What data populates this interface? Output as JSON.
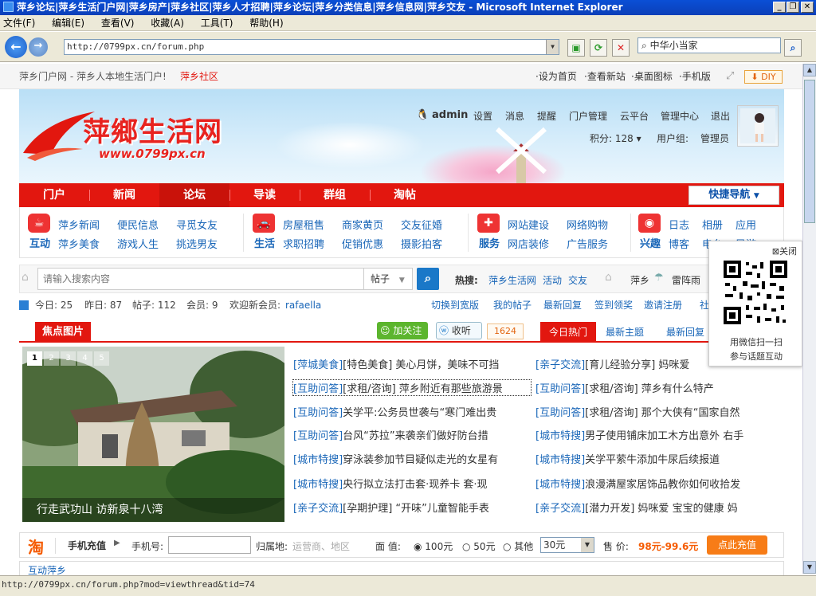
{
  "window": {
    "title": "萍乡论坛|萍乡生活门户网|萍乡房产|萍乡社区|萍乡人才招聘|萍乡论坛|萍乡分类信息|萍乡信息网|萍乡交友 - Microsoft Internet Explorer"
  },
  "menu": [
    "文件(F)",
    "编辑(E)",
    "查看(V)",
    "收藏(A)",
    "工具(T)",
    "帮助(H)"
  ],
  "address": {
    "url": "http://0799px.cn/forum.php"
  },
  "browser_search": {
    "value": "中华小当家"
  },
  "topstrip": {
    "site_desc": "萍乡门户网 - 萍乡人本地生活门户!",
    "community": "萍乡社区",
    "links": [
      "设为首页",
      "查看新站",
      "桌面图标",
      "手机版"
    ],
    "diy": "DIY"
  },
  "banner": {
    "logo_text": "萍鄉生活网",
    "logo_url": "www.0799px.cn",
    "user": "admin",
    "user_links": [
      "设置",
      "消息",
      "提醒",
      "门户管理",
      "云平台",
      "管理中心",
      "退出"
    ],
    "points_label": "积分: 128",
    "group_label": "用户组:",
    "group_value": "管理员"
  },
  "nav": {
    "items": [
      "门户",
      "新闻",
      "论坛",
      "导读",
      "群组",
      "淘帖"
    ],
    "fast_nav": "快捷导航"
  },
  "quick": {
    "groups": [
      {
        "icon": "cup-icon",
        "label": "互动",
        "links": [
          "萍乡新闻",
          "便民信息",
          "寻觅女友",
          "萍乡美食",
          "游戏人生",
          "挑选男友"
        ]
      },
      {
        "icon": "car-icon",
        "label": "生活",
        "links": [
          "房屋租售",
          "商家黄页",
          "交友征婚",
          "求职招聘",
          "促销优惠",
          "摄影拍客"
        ]
      },
      {
        "icon": "toolbox-icon",
        "label": "服务",
        "links": [
          "网站建设",
          "网络购物",
          "网店装修",
          "广告服务"
        ]
      },
      {
        "icon": "camera-icon",
        "label": "兴趣",
        "links": [
          "日志",
          "相册",
          "应用",
          "博客",
          "电台",
          "导游"
        ]
      }
    ]
  },
  "search": {
    "placeholder": "请输入搜索内容",
    "type": "帖子",
    "hot_label": "热搜:",
    "hot": [
      "萍乡生活网",
      "活动",
      "交友"
    ],
    "extra": "萍乡",
    "weather": "雷阵雨"
  },
  "stats": {
    "today": "今日: 25",
    "yesterday": "昨日: 87",
    "posts": "帖子: 112",
    "members": "会员: 9",
    "welcome": "欢迎新会员:",
    "new_member": "rafaella",
    "links": [
      "切换到宽版",
      "我的帖子",
      "最新回复",
      "签到领奖",
      "邀请注册",
      "社"
    ]
  },
  "focus": {
    "tab": "焦点图片",
    "follow": "加关注",
    "listen": "收听",
    "listen_count": "1624",
    "tabs": [
      "今日热门",
      "最新主题",
      "最新回复"
    ],
    "slides": [
      "1",
      "2",
      "3",
      "4",
      "5"
    ],
    "caption": "行走武功山  访新泉十八湾",
    "left_list": [
      {
        "tag": "[萍城美食]",
        "text": "[特色美食] 美心月饼，美味不可挡"
      },
      {
        "tag": "[互助问答]",
        "text": "[求租/咨询] 萍乡附近有那些旅游景"
      },
      {
        "tag": "[互助问答]",
        "text": "关学平:公务员世袭与“寒门难出贵"
      },
      {
        "tag": "[互助问答]",
        "text": "台风“苏拉”来袭亲们做好防台措"
      },
      {
        "tag": "[城市特搜]",
        "text": "穿泳装参加节目疑似走光的女星有"
      },
      {
        "tag": "[城市特搜]",
        "text": "央行拟立法打击套·现养卡  套·现"
      },
      {
        "tag": "[亲子交流]",
        "text": "[孕期护理] “开味”儿童智能手表"
      }
    ],
    "right_list": [
      {
        "tag": "[亲子交流]",
        "text": "[育儿经验分享] 妈咪爱"
      },
      {
        "tag": "[互助问答]",
        "text": "[求租/咨询] 萍乡有什么特产"
      },
      {
        "tag": "[互助问答]",
        "text": "[求租/咨询] 那个大侠有“国家自然"
      },
      {
        "tag": "[城市特搜]",
        "text": "男子使用铺床加工木方出意外  右手"
      },
      {
        "tag": "[城市特搜]",
        "text": "关学平萦牛添加牛尿后续报道"
      },
      {
        "tag": "[城市特搜]",
        "text": "浪漫满屋家居饰品教你如何收拾发"
      },
      {
        "tag": "[亲子交流]",
        "text": "[潜力开发] 妈咪爱  宝宝的健康  妈"
      }
    ]
  },
  "qr": {
    "close": "关闭",
    "line1": "用微信扫一扫",
    "line2": "参与话题互动"
  },
  "recharge": {
    "logo": "淘",
    "title": "手机充值",
    "phone_label": "手机号:",
    "area_label": "归属地:",
    "area_hint": "运营商、地区",
    "amount_label": "面  值:",
    "options": [
      "100元",
      "50元",
      "其他"
    ],
    "select_value": "30元",
    "price_label": "售  价:",
    "price": "98元-99.6元",
    "button": "点此充值"
  },
  "section_peek": "互动萍乡",
  "status": {
    "url": "http://0799px.cn/forum.php?mod=viewthread&tid=74"
  }
}
